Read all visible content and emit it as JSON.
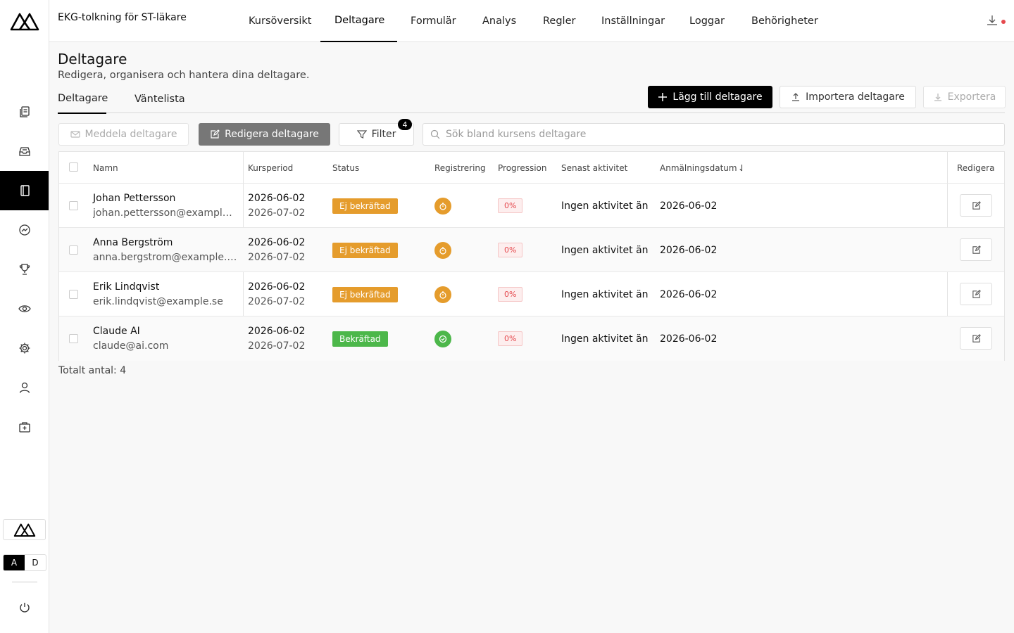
{
  "app": {
    "course_title": "EKG-tolkning för ST-läkare",
    "toggle": {
      "left": "A",
      "right": "D"
    }
  },
  "top_tabs": [
    {
      "label": "Kursöversikt"
    },
    {
      "label": "Deltagare"
    },
    {
      "label": "Formulär"
    },
    {
      "label": "Analys"
    },
    {
      "label": "Regler"
    },
    {
      "label": "Inställningar"
    },
    {
      "label": "Loggar"
    },
    {
      "label": "Behörigheter"
    }
  ],
  "sidebar": {
    "items": [
      {
        "icon": "copy-icon"
      },
      {
        "icon": "inbox-icon"
      },
      {
        "icon": "notebook-icon",
        "active": true
      },
      {
        "icon": "chart-icon"
      },
      {
        "icon": "trophy-icon"
      },
      {
        "icon": "eye-icon"
      },
      {
        "icon": "gear-icon"
      },
      {
        "icon": "user-icon"
      },
      {
        "icon": "medkit-icon"
      }
    ]
  },
  "page": {
    "title": "Deltagare",
    "subtitle": "Redigera, organisera och hantera dina deltagare."
  },
  "subtabs": {
    "participants": "Deltagare",
    "waitlist": "Väntelista"
  },
  "actions": {
    "add": "Lägg till deltagare",
    "import": "Importera deltagare",
    "export": "Exportera"
  },
  "toolbar": {
    "message": "Meddela deltagare",
    "edit": "Redigera deltagare",
    "filter": "Filter",
    "filter_count": "4",
    "search_placeholder": "Sök bland kursens deltagare"
  },
  "table": {
    "headers": {
      "name": "Namn",
      "period": "Kursperiod",
      "status": "Status",
      "registration": "Registrering",
      "progress": "Progression",
      "last_activity": "Senast aktivitet",
      "signup_date": "Anmälningsdatum",
      "edit": "Redigera"
    },
    "rows": [
      {
        "name": "Johan Pettersson",
        "email": "johan.pettersson@example.se",
        "start": "2026-06-02",
        "end": "2026-07-02",
        "status": "Ej bekräftad",
        "progress": "0%",
        "last_activity": "Ingen aktivitet än",
        "signup": "2026-06-02"
      },
      {
        "name": "Anna Bergström",
        "email": "anna.bergstrom@example.se",
        "start": "2026-06-02",
        "end": "2026-07-02",
        "status": "Ej bekräftad",
        "progress": "0%",
        "last_activity": "Ingen aktivitet än",
        "signup": "2026-06-02"
      },
      {
        "name": "Erik Lindqvist",
        "email": "erik.lindqvist@example.se",
        "start": "2026-06-02",
        "end": "2026-07-02",
        "status": "Ej bekräftad",
        "progress": "0%",
        "last_activity": "Ingen aktivitet än",
        "signup": "2026-06-02"
      },
      {
        "name": "Claude AI",
        "email": "claude@ai.com",
        "start": "2026-06-02",
        "end": "2026-07-02",
        "status": "Bekräftad",
        "progress": "0%",
        "last_activity": "Ingen aktivitet än",
        "signup": "2026-06-02"
      }
    ],
    "total": "Totalt antal: 4"
  },
  "colors": {
    "pending": "#e59c2c",
    "confirmed": "#4cb74a",
    "progress_red": "#e5484d",
    "accent": "#000000"
  }
}
